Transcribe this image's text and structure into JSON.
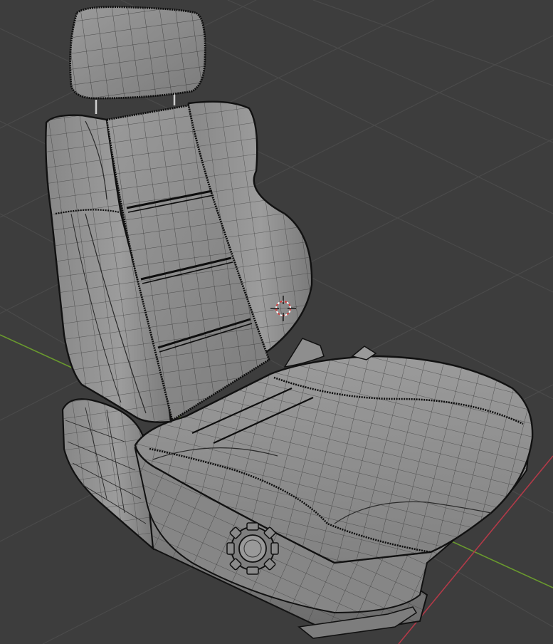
{
  "viewport": {
    "background_color": "#3d3d3d",
    "grid_color": "#4a4a4a",
    "x_axis_color": "#b23a48",
    "y_axis_color": "#6a9a2e",
    "mesh_face_color": "#8c8c8c",
    "mesh_shadow_color": "#6e6e6e",
    "mesh_highlight_color": "#a3a3a3",
    "wire_color": "#1b1b1b",
    "seam_color": "#0e0e0e"
  },
  "objects": {
    "model": "car-seat-mesh",
    "cursor_icon": "3d-cursor-icon"
  }
}
